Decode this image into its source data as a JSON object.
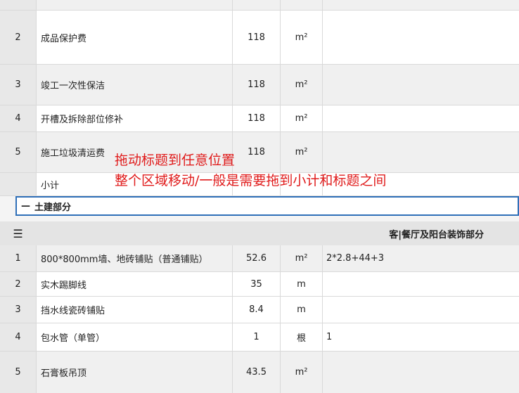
{
  "section1": {
    "rows": [
      {
        "num": "2",
        "name": "成品保护费",
        "qty": "118",
        "unit": "m²",
        "note": ""
      },
      {
        "num": "3",
        "name": "竣工一次性保洁",
        "qty": "118",
        "unit": "m²",
        "note": ""
      },
      {
        "num": "4",
        "name": "开槽及拆除部位修补",
        "qty": "118",
        "unit": "m²",
        "note": ""
      },
      {
        "num": "5",
        "name": "施工垃圾清运费",
        "qty": "118",
        "unit": "m²",
        "note": ""
      }
    ],
    "subtotal_label": "小计"
  },
  "drag_section": {
    "collapse_icon": "—",
    "label": "土建部分"
  },
  "group_header": {
    "menu_icon": "☰",
    "title": "客|餐厅及阳台装饰部分"
  },
  "section2": {
    "rows": [
      {
        "num": "1",
        "name": "800*800mm墙、地砖铺贴（普通铺贴）",
        "qty": "52.6",
        "unit": "m²",
        "note": "2*2.8+44+3"
      },
      {
        "num": "2",
        "name": "实木踢脚线",
        "qty": "35",
        "unit": "m",
        "note": ""
      },
      {
        "num": "3",
        "name": "挡水线瓷砖铺贴",
        "qty": "8.4",
        "unit": "m",
        "note": ""
      },
      {
        "num": "4",
        "name": "包水管（单管）",
        "qty": "1",
        "unit": "根",
        "note": "1"
      },
      {
        "num": "5",
        "name": "石膏板吊顶",
        "qty": "43.5",
        "unit": "m²",
        "note": ""
      }
    ]
  },
  "annotation": {
    "line1": "拖动标题到任意位置",
    "line2": "整个区域移动/一般是需要拖到小计和标题之间"
  },
  "colors": {
    "annotation": "#e01b1b",
    "selection_border": "#2f6fb8"
  }
}
